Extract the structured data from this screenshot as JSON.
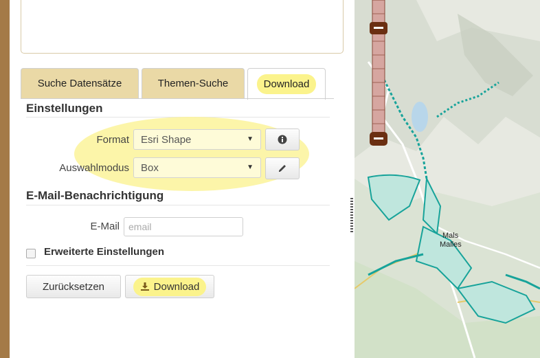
{
  "tabs": [
    {
      "label": "Suche Datensätze",
      "active": false
    },
    {
      "label": "Themen-Suche",
      "active": false
    },
    {
      "label": "Download",
      "active": true
    }
  ],
  "settings": {
    "title": "Einstellungen",
    "format_label": "Format",
    "format_value": "Esri Shape",
    "mode_label": "Auswahlmodus",
    "mode_value": "Box",
    "info_icon": "info-circle-icon",
    "edit_icon": "pencil-icon"
  },
  "email_section": {
    "title": "E-Mail-Benachrichtigung",
    "email_label": "E-Mail",
    "email_placeholder": "email",
    "email_value": ""
  },
  "advanced": {
    "label": "Erweiterte Einstellungen",
    "checked": false
  },
  "buttons": {
    "reset": "Zurücksetzen",
    "download": "Download",
    "download_icon": "download-icon"
  },
  "map": {
    "places": [
      "Mals",
      "Malles"
    ]
  },
  "colors": {
    "accent_tab": "#ead9a6",
    "highlight": "#fbf38c",
    "border": "#a47a47",
    "feature": "#17a39a"
  }
}
